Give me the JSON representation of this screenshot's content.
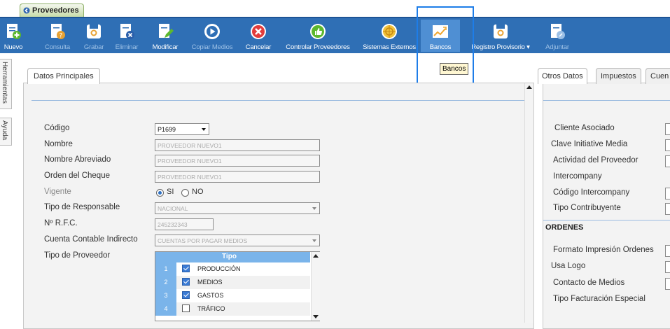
{
  "window": {
    "tab_title": "Proveedores"
  },
  "toolbar": {
    "items": [
      {
        "label": "Nuevo",
        "icon": "doc-plus-icon",
        "enabled": true
      },
      {
        "label": "Consulta",
        "icon": "doc-question-icon",
        "enabled": false
      },
      {
        "label": "Grabar",
        "icon": "save-icon",
        "enabled": false
      },
      {
        "label": "Eliminar",
        "icon": "doc-delete-icon",
        "enabled": false
      },
      {
        "label": "Modificar",
        "icon": "doc-edit-icon",
        "enabled": true
      },
      {
        "label": "Copiar Medios",
        "icon": "play-icon",
        "enabled": false
      },
      {
        "label": "Cancelar",
        "icon": "cancel-icon",
        "enabled": true
      },
      {
        "label": "Controlar Proveedores",
        "icon": "thumbs-up-icon",
        "enabled": true
      },
      {
        "label": "Sistemas Externos",
        "icon": "globe-icon",
        "enabled": true
      },
      {
        "label": "Bancos",
        "icon": "chart-line-icon",
        "enabled": true
      },
      {
        "label": "Registro Provisorio",
        "icon": "save-icon",
        "enabled": true,
        "dropdown": true
      },
      {
        "label": "Adjuntar",
        "icon": "attach-icon",
        "enabled": false
      }
    ],
    "tooltip": "Bancos"
  },
  "sidebar": {
    "tabs": [
      "Herramientas",
      "Ayuda"
    ]
  },
  "left_panel": {
    "tab": "Datos Principales",
    "fields": {
      "codigo_label": "Código",
      "codigo_value": "P1699",
      "nombre_label": "Nombre",
      "nombre_value": "PROVEEDOR NUEVO1",
      "abreviado_label": "Nombre Abreviado",
      "abreviado_value": "PROVEEDOR NUEVO1",
      "cheque_label": "Orden del Cheque",
      "cheque_value": "PROVEEDOR NUEVO1",
      "vigente_label": "Vigente",
      "vigente_si": "SI",
      "vigente_no": "NO",
      "responsable_label": "Tipo de Responsable",
      "responsable_value": "NACIONAL",
      "rfc_label": "Nº R.F.C.",
      "rfc_value": "245232343",
      "cuenta_label": "Cuenta Contable Indirecto",
      "cuenta_value": "CUENTAS POR PAGAR MEDIOS",
      "tipo_proveedor_label": "Tipo de Proveedor"
    },
    "grid": {
      "header": "Tipo",
      "rows": [
        {
          "num": "1",
          "checked": true,
          "tipo": "PRODUCCIÓN"
        },
        {
          "num": "2",
          "checked": true,
          "tipo": "MEDIOS"
        },
        {
          "num": "3",
          "checked": true,
          "tipo": "GASTOS"
        },
        {
          "num": "4",
          "checked": false,
          "tipo": "TRÁFICO"
        }
      ]
    }
  },
  "right_panel": {
    "tabs": [
      "Otros Datos",
      "Impuestos",
      "Cuen"
    ],
    "fields": [
      "Cliente Asociado",
      "Clave Initiative Media",
      "Actividad del Proveedor",
      "Intercompany",
      "Código Intercompany",
      "Tipo Contribuyente"
    ],
    "ordenes_title": "ORDENES",
    "ordenes_fields": [
      "Formato Impresión Ordenes",
      "Usa Logo",
      "Contacto de Medios",
      "Tipo Facturación Especial"
    ]
  },
  "colors": {
    "toolbar_bg": "#2f6fb5",
    "grid_header": "#7ab4ea",
    "selection_box": "#1e7de8"
  }
}
